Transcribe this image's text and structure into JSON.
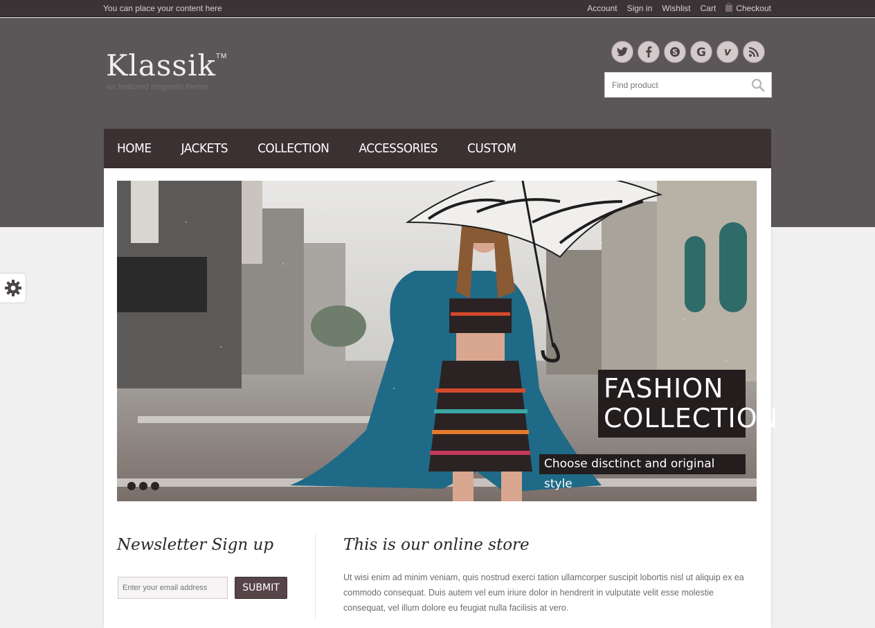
{
  "topbar": {
    "welcome": "You can place your content here",
    "links": [
      "Account",
      "Sign in",
      "Wishlist",
      "Cart"
    ],
    "checkout": "Checkout"
  },
  "header": {
    "logo": "Klassik",
    "trademark": "TM",
    "tagline": "an featured magento theme",
    "social": [
      "twitter-icon",
      "facebook-icon",
      "skype-icon",
      "google-icon",
      "vimeo-icon",
      "rss-icon"
    ],
    "search_placeholder": "Find product"
  },
  "nav": {
    "items": [
      "HOME",
      "JACKETS",
      "COLLECTION",
      "ACCESSORIES",
      "CUSTOM"
    ]
  },
  "slider": {
    "title_line1": "FASHION",
    "title_line2": "COLLECTION",
    "subtitle": "Choose disctinct and original style",
    "dots": 3
  },
  "newsletter": {
    "title": "Newsletter Sign up",
    "placeholder": "Enter your email address",
    "submit": "SUBMIT"
  },
  "store": {
    "title": "This is our online store",
    "text": "Ut wisi enim ad minim veniam, quis nostrud exerci tation ullamcorper suscipit lobortis nisl ut aliquip ex ea commodo consequat. Duis autem vel eum iriure dolor in hendrerit in vulputate velit esse molestie consequat, vel illum dolore eu feugiat nulla facilisis at vero."
  },
  "colors": {
    "topbar": "#3a3436",
    "header": "#5b5658",
    "nav": "#3b3133",
    "button": "#574449"
  }
}
